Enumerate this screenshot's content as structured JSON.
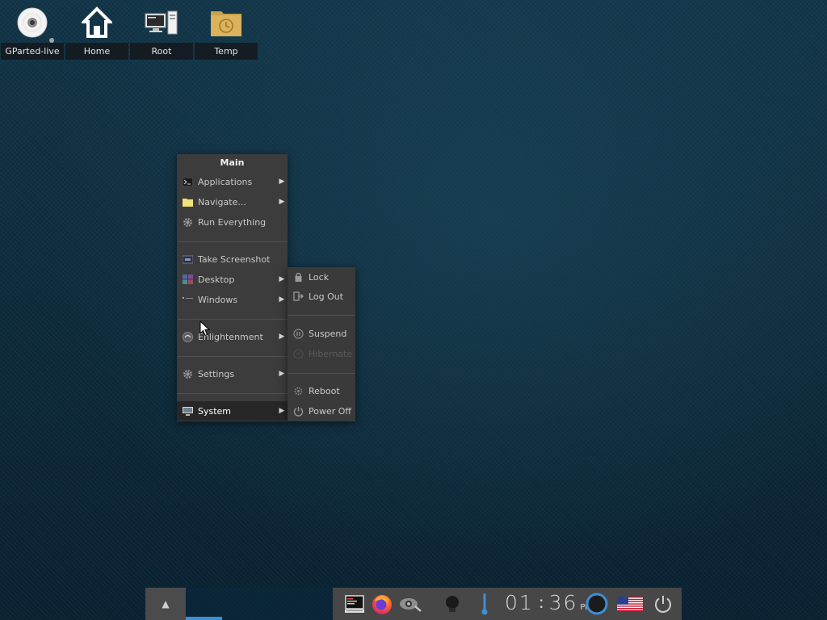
{
  "desktop_icons": [
    {
      "label": "GParted-live",
      "icon": "cd-icon"
    },
    {
      "label": "Home",
      "icon": "home-icon"
    },
    {
      "label": "Root",
      "icon": "computer-icon"
    },
    {
      "label": "Temp",
      "icon": "folder-clock-icon"
    }
  ],
  "main_menu": {
    "title": "Main",
    "items": [
      {
        "label": "Applications",
        "icon": "terminal-icon",
        "submenu": true
      },
      {
        "label": "Navigate...",
        "icon": "folder-icon",
        "submenu": true
      },
      {
        "label": "Run Everything",
        "icon": "gear-icon",
        "submenu": false
      },
      {
        "label": "Take Screenshot",
        "icon": "screenshot-icon",
        "submenu": false
      },
      {
        "label": "Desktop",
        "icon": "desktop-icon",
        "submenu": true
      },
      {
        "label": "Windows",
        "icon": "windows-icon",
        "submenu": true
      },
      {
        "label": "Enlightenment",
        "icon": "enlightenment-icon",
        "submenu": true
      },
      {
        "label": "Settings",
        "icon": "gear-icon",
        "submenu": true
      },
      {
        "label": "System",
        "icon": "monitor-icon",
        "submenu": true,
        "active": true
      }
    ]
  },
  "system_menu": {
    "items": [
      {
        "label": "Lock",
        "icon": "lock-icon"
      },
      {
        "label": "Log Out",
        "icon": "logout-icon"
      },
      {
        "label": "Suspend",
        "icon": "suspend-icon"
      },
      {
        "label": "Hibernate",
        "icon": "hibernate-icon",
        "disabled": true
      },
      {
        "label": "Reboot",
        "icon": "reboot-icon"
      },
      {
        "label": "Power Off",
        "icon": "power-icon"
      }
    ]
  },
  "taskbar": {
    "shelf_toggle": "▲",
    "clock": {
      "hours": "01",
      "minutes": "36",
      "ampm": "PM"
    },
    "icons": [
      "terminal-launcher-icon",
      "firefox-icon",
      "screenshot-tool-icon",
      "bulb-icon",
      "thermometer-icon",
      "network-icon",
      "us-flag-icon",
      "power-button-icon"
    ],
    "accent_color": "#3d8fd6"
  }
}
